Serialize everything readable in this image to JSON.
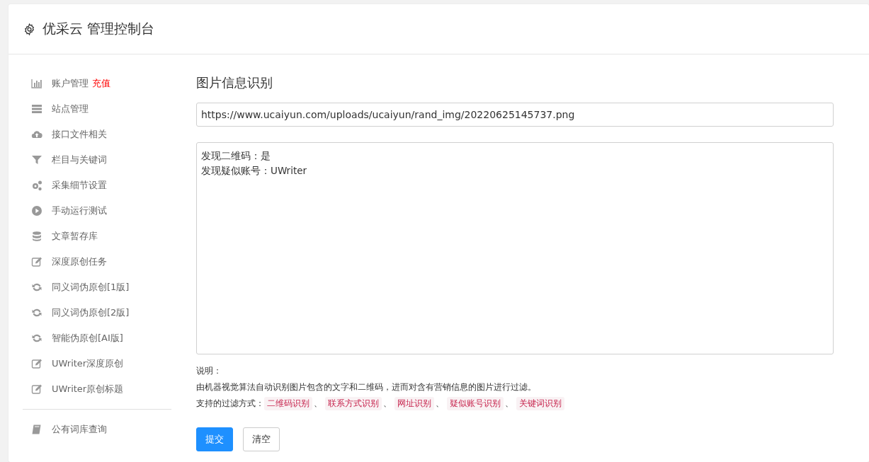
{
  "header": {
    "title": "优采云 管理控制台"
  },
  "sidebar": {
    "groups": [
      [
        {
          "label": "账户管理",
          "badge": "充值"
        },
        {
          "label": "站点管理"
        },
        {
          "label": "接口文件相关"
        },
        {
          "label": "栏目与关键词"
        },
        {
          "label": "采集细节设置"
        },
        {
          "label": "手动运行测试"
        },
        {
          "label": "文章暂存库"
        },
        {
          "label": "深度原创任务"
        },
        {
          "label": "同义词伪原创[1版]"
        },
        {
          "label": "同义词伪原创[2版]"
        },
        {
          "label": "智能伪原创[AI版]"
        },
        {
          "label": "UWriter深度原创"
        },
        {
          "label": "UWriter原创标题"
        }
      ],
      [
        {
          "label": "公有词库查询"
        }
      ]
    ]
  },
  "main": {
    "title": "图片信息识别",
    "url_field": {
      "value": "https://www.ucaiyun.com/uploads/ucaiyun/rand_img/20220625145737.png"
    },
    "result_box": {
      "lines": [
        "发现二维码：是",
        "发现疑似账号：UWriter"
      ]
    },
    "notes_title": "说明：",
    "description": "由机器视觉算法自动识别图片包含的文字和二维码，进而对含有营销信息的图片进行过滤。",
    "filters_label": "支持的过滤方式：",
    "separator": "、",
    "filters": [
      "二维码识别",
      "联系方式识别",
      "网址识别",
      "疑似账号识别",
      "关键词识别"
    ],
    "buttons": [
      {
        "label": "提交",
        "kind": "primary"
      },
      {
        "label": "清空",
        "kind": "default"
      }
    ]
  }
}
